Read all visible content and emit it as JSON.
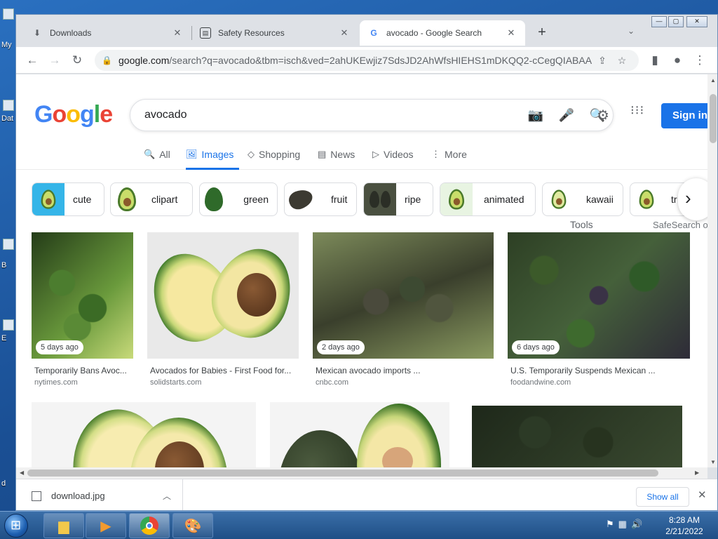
{
  "desktop": {
    "labels": [
      "My",
      "Dat",
      "B",
      "E",
      "d"
    ]
  },
  "browser": {
    "tabs": [
      {
        "title": "Downloads",
        "icon": "download-icon",
        "close": "✕"
      },
      {
        "title": "Safety Resources",
        "icon": "document-icon",
        "close": "✕"
      },
      {
        "title": "avocado - Google Search",
        "icon": "google-g-icon",
        "close": "✕"
      }
    ],
    "new_tab": "+",
    "tab_menu": "⌄",
    "address": {
      "host": "google.com",
      "path": "/search?q=avocado&tbm=isch&ved=2ahUKEwjiz7SdsJD2AhWfsHIEHS1mDKQQ2-cCegQIABAA..."
    }
  },
  "google": {
    "logo_letters": [
      "G",
      "o",
      "o",
      "g",
      "l",
      "e"
    ],
    "query": "avocado",
    "sign_in": "Sign in",
    "nav_tabs": [
      {
        "label": "All",
        "icon": "🔍",
        "active": false
      },
      {
        "label": "Images",
        "icon": "🖼",
        "active": true
      },
      {
        "label": "Shopping",
        "icon": "◇",
        "active": false
      },
      {
        "label": "News",
        "icon": "▤",
        "active": false
      },
      {
        "label": "Videos",
        "icon": "▷",
        "active": false
      },
      {
        "label": "More",
        "icon": "⋮",
        "active": false
      }
    ],
    "tools": "Tools",
    "safesearch": "SafeSearch o",
    "chips": [
      "cute",
      "clipart",
      "green",
      "fruit",
      "ripe",
      "animated",
      "kawaii",
      "tr"
    ],
    "results": [
      {
        "age": "5 days ago",
        "title": "Temporarily Bans Avoc...",
        "source": "nytimes.com"
      },
      {
        "age": "",
        "title": "Avocados for Babies - First Food for...",
        "source": "solidstarts.com"
      },
      {
        "age": "2 days ago",
        "title": "Mexican avocado imports ...",
        "source": "cnbc.com"
      },
      {
        "age": "6 days ago",
        "title": "U.S. Temporarily Suspends Mexican ...",
        "source": "foodandwine.com"
      }
    ]
  },
  "downloads": {
    "file": "download.jpg",
    "show_all": "Show all"
  },
  "taskbar": {
    "time": "8:28 AM",
    "date": "2/21/2022"
  },
  "colors": {
    "accent": "#1a73e8",
    "taskbar": "#2a5e9a"
  }
}
